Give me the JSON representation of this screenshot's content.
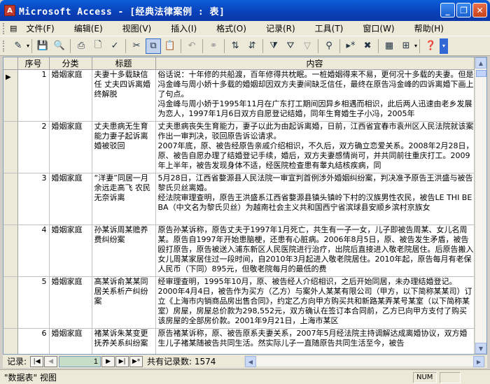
{
  "window": {
    "title": "Microsoft Access - [经典法律案例 : 表]"
  },
  "menu": [
    "文件(F)",
    "编辑(E)",
    "视图(V)",
    "插入(I)",
    "格式(O)",
    "记录(R)",
    "工具(T)",
    "窗口(W)",
    "帮助(H)"
  ],
  "columns": [
    "序号",
    "分类",
    "标题",
    "内容"
  ],
  "rows": [
    {
      "id": "1",
      "category": "婚姻家庭",
      "title": "夫妻十多载缺信任 丈夫四诉离婚终解脱",
      "content": "俗话说：十年修的共船渡，百年修得共枕眠。一桩婚姻得来不易，更何况十多载的夫妻。但是冯金峰与周小娇十多载的婚姻却因双方夫妻间缺乏信任，最终在原告冯金峰的四诉离婚下画上了句点。\n冯金峰与周小娇于1995年11月在广东打工期间因异乡相遇而相识，此后两人迅速由老乡发展为恋人，1997年1月6日双方自愿登记结婚，同年生育婚生子小冯，2005年"
    },
    {
      "id": "2",
      "category": "婚姻家庭",
      "title": "丈夫患病无生育能力妻子起诉离婚被驳回",
      "content": "丈夫患病丧失生育能力，妻子以此为由起诉离婚，日前，江西省宜春市袁州区人民法院就该案作出一审判决，驳回原告诉讼请求。\n2007年底，原、被告经原告亲戚介绍相识，不久后，双方确立恋爱关系。2008年2月28日，原、被告自愿办理了结婚登记手续，婚后，双方夫妻感情尚可，并共同前往重庆打工。2009年上半年，被告发现身体不适，经医院检查患有睾丸结核疾病，同"
    },
    {
      "id": "3",
      "category": "婚姻家庭",
      "title": "“洋妻”同居一月余远走高飞 农民无奈诉离",
      "content": "5月28日，江西省婺源县人民法院一审宣判首例涉外婚姻纠纷案，判决准予原告王洪盛与被告黎氏贝丝离婚。\n经法院审理查明，原告王洪盛系江西省婺源县镇头镇岭下村的汉族男性农民，被告LE THI BE\nBA（中文名为黎氏贝丝）为越南社会主义共和国西宁省滨球县安顺乡滨村京族女"
    },
    {
      "id": "4",
      "category": "婚姻家庭",
      "title": "孙某诉周某赡养费纠纷案",
      "content": "原告孙某诉称，原告丈夫于1997年1月死亡，共生有一子一女，儿子即被告周某、女儿名周某。原告自1997年开始患脑梗，还患有心脏病。2006年8月5日，原、被告发生矛盾，被告殴打原告，原告被送入浦东新区人民医院进行治疗，出院后直接进入敬老院居住。后原告搬入女儿周某家居住过一段时间，自2010年3月起进入敬老院居住。2010年起，原告每月有老保人民币（下同）895元，但敬老院每月的最低的费"
    },
    {
      "id": "5",
      "category": "婚姻家庭",
      "title": "高某诉俞某某同居关系析产纠纷案",
      "content": "经审理查明，1995年10月，原、被告经人介绍相识，之后开始同居，未办理结婚登记。2000年4月4日，被告作为买方（乙方）与案外人某某有限公司（甲方，以下简称某某司）订立《上海市内销商品房出售合同》，约定乙方向甲方购买共和新路某弄某号某室（以下简称某室）房屋，房屋总价款为298,552元，双方确认在签订本合同前，乙方已向甲方支付了购买该房屋的全部房价款。2001年9月21日，上海市某区"
    },
    {
      "id": "6",
      "category": "婚姻家庭",
      "title": "褚某诉朱某变更抚养关系纠纷案",
      "content": "原告褚某诉称，原、被告原系夫妻关系，2007年5月经法院主持调解达成离婚协议，双方婚生儿子褚某随被告共同生活。然实际儿子一直随原告共同生活至今，被告"
    }
  ],
  "nav": {
    "label": "记录:",
    "current": "1",
    "total_label": "共有记录数: 1574"
  },
  "status": {
    "view": "\"数据表\" 视图",
    "num": "NUM"
  }
}
